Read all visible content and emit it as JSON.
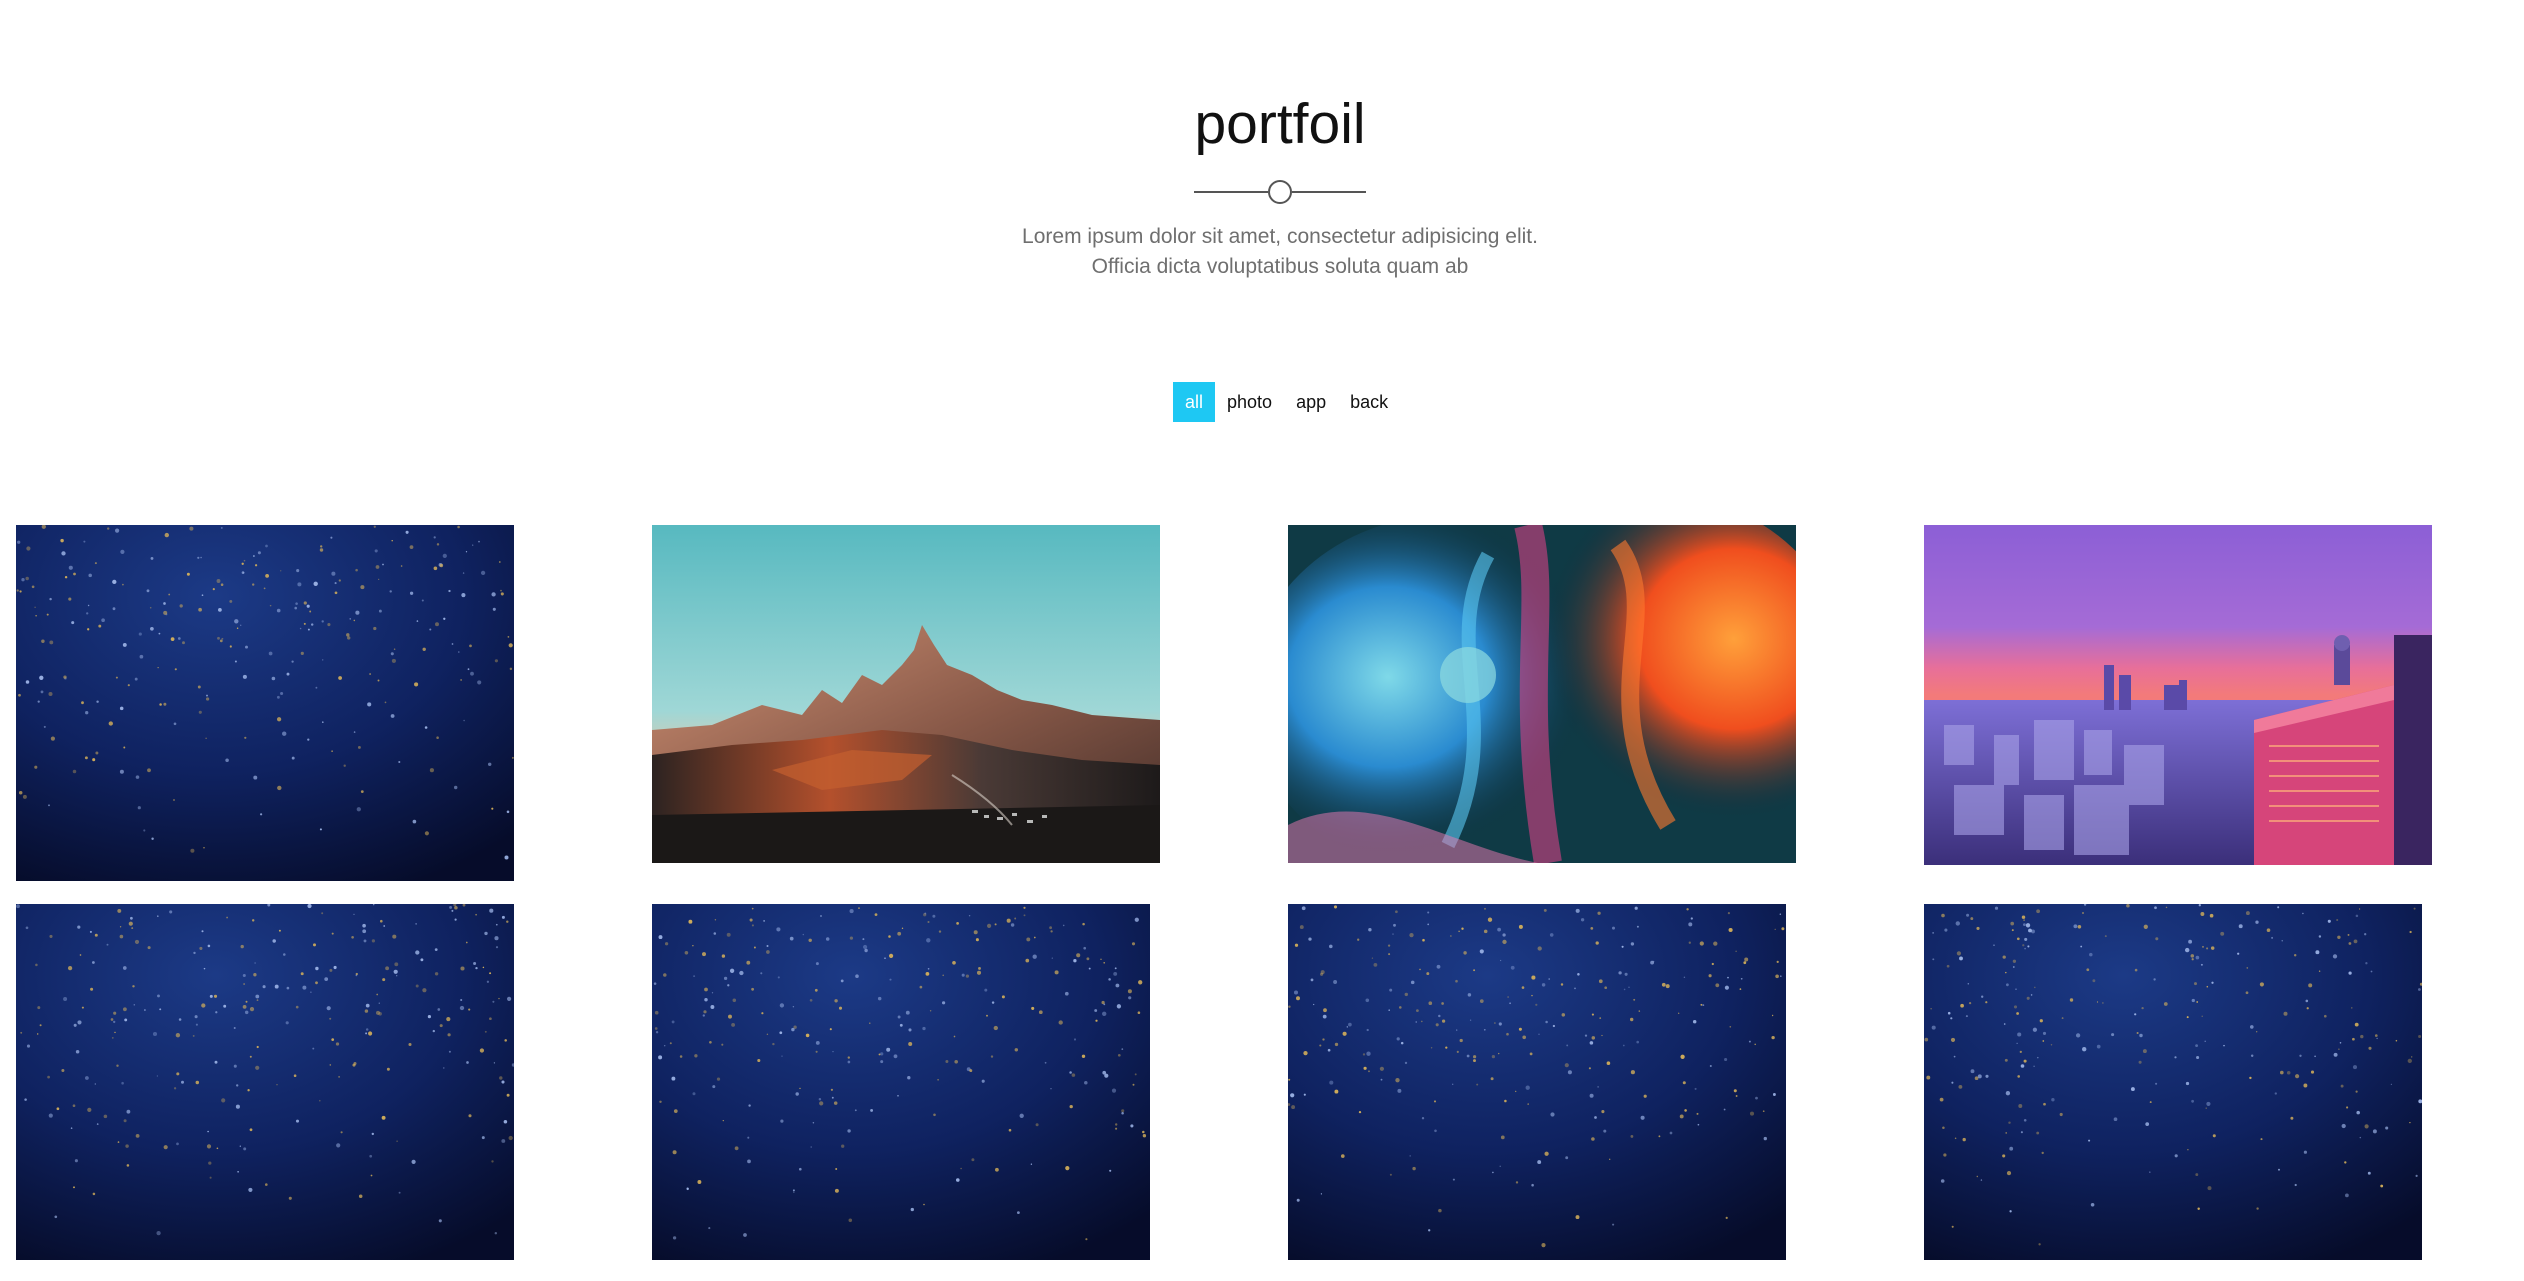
{
  "section": {
    "title": "portfoil",
    "subtitle_line1": "Lorem ipsum dolor sit amet, consectetur adipisicing elit.",
    "subtitle_line2": "Officia dicta voluptatibus soluta quam ab"
  },
  "filters": {
    "items": [
      {
        "label": "all",
        "active": true
      },
      {
        "label": "photo",
        "active": false
      },
      {
        "label": "app",
        "active": false
      },
      {
        "label": "back",
        "active": false
      }
    ]
  },
  "colors": {
    "accent": "#1ec8f3",
    "title": "#111111",
    "subtitle": "#6f6f6f",
    "divider": "#555555"
  },
  "gallery": {
    "items": [
      {
        "image": "starry-night-texture"
      },
      {
        "image": "mountain-sunset"
      },
      {
        "image": "blue-orange-ink-smoke"
      },
      {
        "image": "city-skyline-purple-dusk"
      },
      {
        "image": "starry-night-texture"
      },
      {
        "image": "starry-night-texture"
      },
      {
        "image": "starry-night-texture"
      },
      {
        "image": "starry-night-texture"
      }
    ]
  }
}
